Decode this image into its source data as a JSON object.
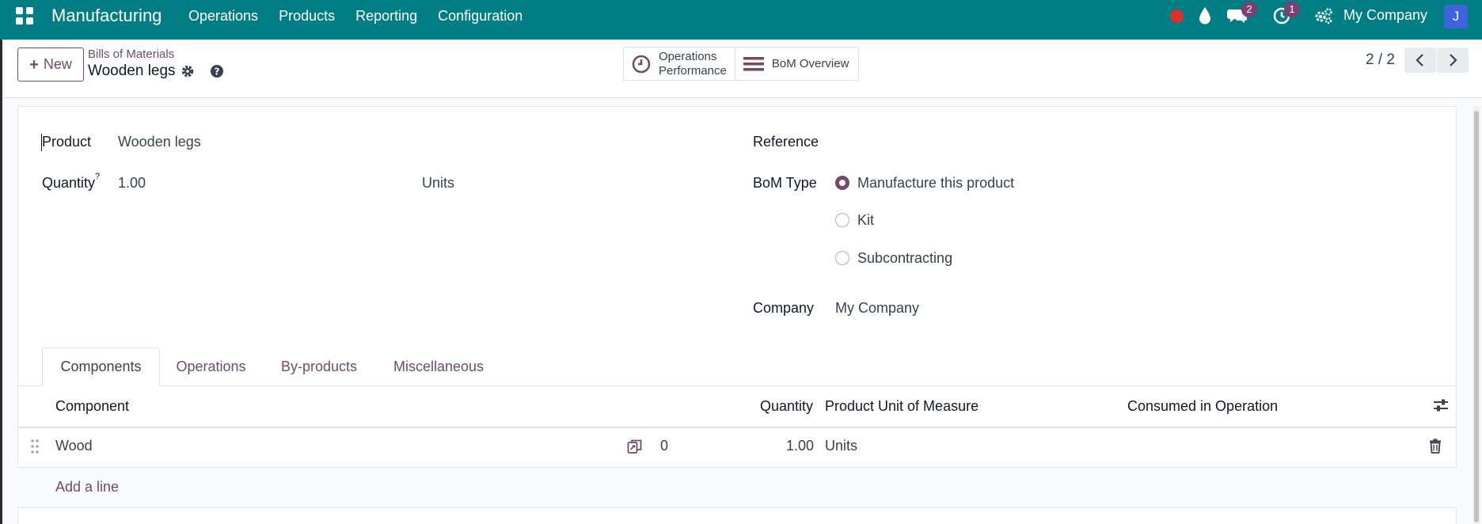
{
  "navbar": {
    "brand": "Manufacturing",
    "menu": [
      "Operations",
      "Products",
      "Reporting",
      "Configuration"
    ],
    "chat_badge": "2",
    "activity_badge": "1",
    "company": "My Company",
    "avatar_initial": "J",
    "color": "#017e84"
  },
  "control": {
    "new_label": "New",
    "breadcrumb": "Bills of Materials",
    "record_title": "Wooden legs",
    "smart_buttons": {
      "ops_perf_line1": "Operations",
      "ops_perf_line2": "Performance",
      "bom_overview": "BoM Overview"
    },
    "pager": "2 / 2"
  },
  "form": {
    "product_label": "Product",
    "product_value": "Wooden legs",
    "quantity_label": "Quantity",
    "quantity_help": "?",
    "quantity_value": "1.00",
    "uom_value": "Units",
    "reference_label": "Reference",
    "bom_type_label": "BoM Type",
    "bom_type_options": [
      "Manufacture this product",
      "Kit",
      "Subcontracting"
    ],
    "bom_type_selected": "Manufacture this product",
    "company_label": "Company",
    "company_value": "My Company"
  },
  "tabs": [
    "Components",
    "Operations",
    "By-products",
    "Miscellaneous"
  ],
  "active_tab": "Components",
  "table": {
    "headers": [
      "Component",
      "Quantity",
      "Product Unit of Measure",
      "Consumed in Operation"
    ],
    "rows": [
      {
        "component": "Wood",
        "forecast": "0",
        "quantity": "1.00",
        "uom": "Units",
        "operation": ""
      }
    ],
    "add_line": "Add a line"
  },
  "accent_color": "#714b67"
}
